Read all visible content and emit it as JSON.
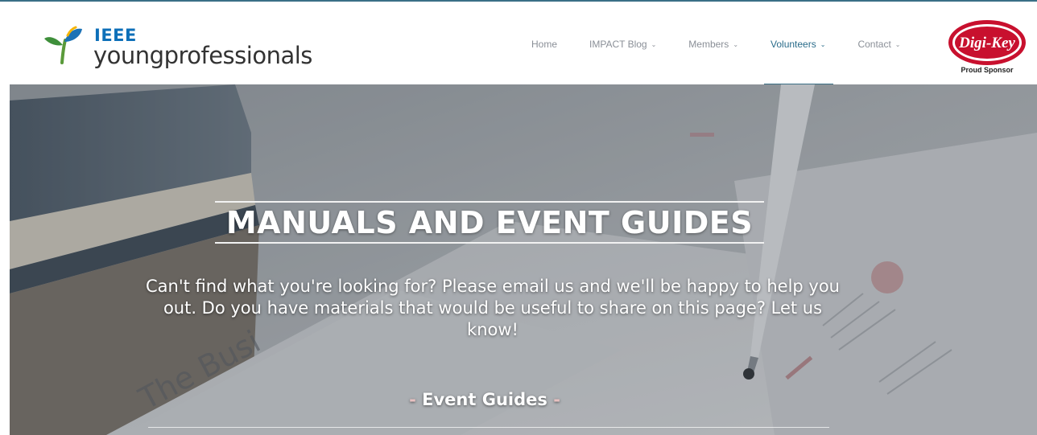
{
  "brand": {
    "ieee": "IEEE",
    "name": "youngprofessionals"
  },
  "nav": {
    "items": [
      {
        "label": "Home",
        "has_dropdown": false,
        "active": false
      },
      {
        "label": "IMPACT Blog",
        "has_dropdown": true,
        "active": false
      },
      {
        "label": "Members",
        "has_dropdown": true,
        "active": false
      },
      {
        "label": "Volunteers",
        "has_dropdown": true,
        "active": true
      },
      {
        "label": "Contact",
        "has_dropdown": true,
        "active": false
      }
    ],
    "active_color": "#3a6f86"
  },
  "sponsor": {
    "logo_text": "Digi-Key",
    "label": "Proud Sponsor",
    "color": "#c8102e"
  },
  "hero": {
    "title": "MANUALS AND EVENT GUIDES",
    "subtitle": "Can't find what you're looking for? Please email us and we'll be happy to help you out. Do you have materials that would be useful to share on this page? Let us know!",
    "section_heading": "Event Guides",
    "section_prefix": "-",
    "section_suffix": "-"
  },
  "icons": {
    "logo": "ieee-yp-sprout-icon",
    "dropdown": "chevron-down-icon"
  }
}
